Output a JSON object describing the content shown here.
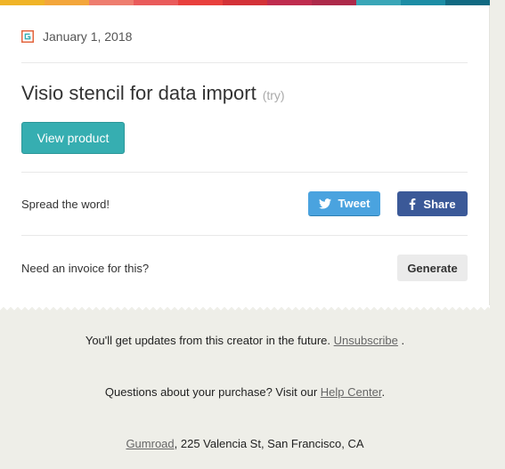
{
  "receipt": {
    "date": "January 1, 2018",
    "product_title": "Visio stencil for data import",
    "try_label": "(try)",
    "view_button": "View product",
    "share_prompt": "Spread the word!",
    "tweet_label": "Tweet",
    "share_label": "Share",
    "invoice_prompt": "Need an invoice for this?",
    "generate_label": "Generate"
  },
  "footer": {
    "updates_text": "You'll get updates from this creator in the future.",
    "unsubscribe_link": "Unsubscribe",
    "updates_end": ".",
    "questions_text": "Questions about your purchase? Visit our",
    "help_link": "Help Center",
    "questions_end": ".",
    "company_link": "Gumroad",
    "address": ", 225 Valencia St, San Francisco, CA"
  },
  "colors": {
    "accent": "#36aeb1",
    "twitter": "#4aa3df",
    "facebook": "#3b5998",
    "stripe": [
      "#f0b428",
      "#f3a63b",
      "#ee7d6f",
      "#e95b5b",
      "#e8403d",
      "#d33238",
      "#bf2c4e",
      "#ad2a4a",
      "#3aa6b7",
      "#1d8da5",
      "#116a82"
    ]
  },
  "icons": {
    "logo": "gumroad-logo-icon",
    "twitter": "twitter-bird-icon",
    "facebook": "facebook-f-icon"
  }
}
